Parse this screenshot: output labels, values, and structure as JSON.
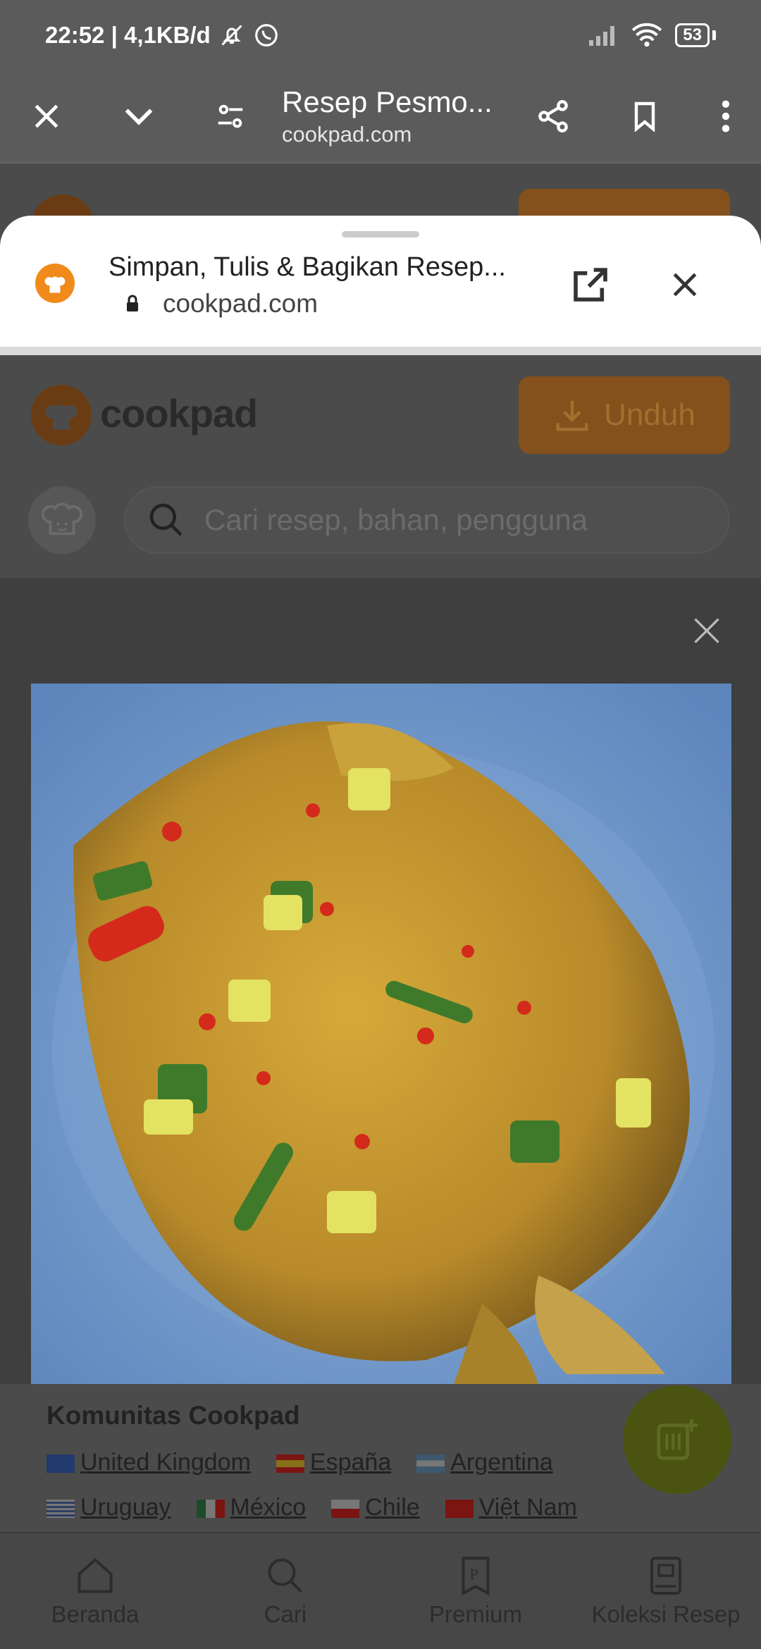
{
  "status_bar": {
    "time_info": "22:52 | 4,1KB/d",
    "battery": "53"
  },
  "toolbar": {
    "title": "Resep Pesmo...",
    "url": "cookpad.com"
  },
  "sheet": {
    "title": "Simpan, Tulis & Bagikan Resep...",
    "url": "cookpad.com"
  },
  "site": {
    "logo_text": "cookpad",
    "download_label": "Unduh",
    "search_placeholder": "Cari resep, bahan, pengguna"
  },
  "footer": {
    "heading": "Komunitas Cookpad",
    "row1": [
      "United Kingdom",
      "España",
      "Argentina"
    ],
    "row2": [
      "Uruguay",
      "México",
      "Chile",
      "Việt Nam"
    ]
  },
  "bottom_nav": {
    "items": [
      "Beranda",
      "Cari",
      "Premium",
      "Koleksi Resep"
    ]
  },
  "colors": {
    "accent_orange": "#f08a1a",
    "fab_green": "#4a5410"
  }
}
